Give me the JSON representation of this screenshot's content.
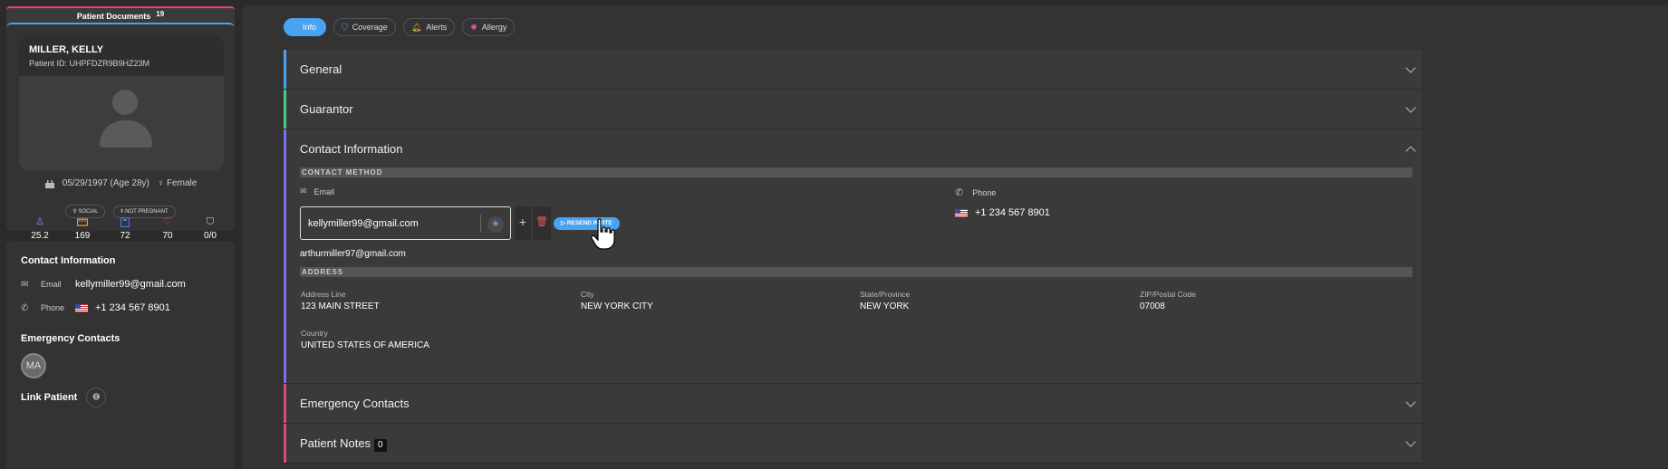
{
  "patient_documents": {
    "label": "Patient Documents",
    "count": "19"
  },
  "patient": {
    "name": "MILLER, KELLY",
    "id_text": "Patient ID: UHPFDZR9B9HZ23M",
    "dob": "05/29/1997 (Age 28y)",
    "sex": "Female",
    "tags": [
      "SOCIAL",
      "NOT PREGNANT"
    ],
    "vitals": [
      {
        "icon": "body-icon",
        "value": "25.2",
        "color": "#9a7cf0"
      },
      {
        "icon": "ruler-icon",
        "value": "169",
        "color": "#e6a23c"
      },
      {
        "icon": "weight-icon",
        "value": "72",
        "color": "#4a78f0"
      },
      {
        "icon": "heart-pulse-icon",
        "value": "70",
        "color": "#e05b8a"
      },
      {
        "icon": "lungs-icon",
        "value": "0/0",
        "color": "#c06be0"
      }
    ]
  },
  "sidebar_contact": {
    "title": "Contact Information",
    "email_label": "Email",
    "email_value": "kellymiller99@gmail.com",
    "phone_label": "Phone",
    "phone_value": "+1 234 567 8901",
    "emergency_title": "Emergency Contacts",
    "emergency_initials": "MA",
    "link_label": "Link Patient"
  },
  "tabs": [
    {
      "label": "Info",
      "active": true,
      "icon": "info-icon"
    },
    {
      "label": "Coverage",
      "active": false,
      "icon": "shield-icon"
    },
    {
      "label": "Alerts",
      "active": false,
      "icon": "bell-icon"
    },
    {
      "label": "Allergy",
      "active": false,
      "icon": "allergy-icon"
    }
  ],
  "sections": {
    "general": "General",
    "guarantor": "Guarantor",
    "contact": "Contact Information",
    "emergency": "Emergency Contacts",
    "notes": "Patient Notes",
    "notes_count": "0"
  },
  "contact_method": {
    "band": "CONTACT METHOD",
    "email_label": "Email",
    "email_value": "kellymiller99@gmail.com",
    "resend_label": "RESEND INVITE",
    "alt_email": "arthurmiller97@gmail.com",
    "phone_label": "Phone",
    "phone_value": "+1 234 567 8901"
  },
  "address": {
    "band": "ADDRESS",
    "line_label": "Address Line",
    "line_value": "123 MAIN STREET",
    "city_label": "City",
    "city_value": "NEW YORK CITY",
    "state_label": "State/Province",
    "state_value": "NEW YORK",
    "zip_label": "ZIP/Postal Code",
    "zip_value": "07008",
    "country_label": "Country",
    "country_value": "UNITED STATES OF AMERICA"
  },
  "colors": {
    "accent_blue": "#4aa3f0",
    "general_bar": "#4aa3f0",
    "guarantor_bar": "#3ecf8e",
    "contact_bar": "#7b6cf0",
    "emergency_bar": "#e0457b",
    "notes_bar": "#e0457b"
  }
}
